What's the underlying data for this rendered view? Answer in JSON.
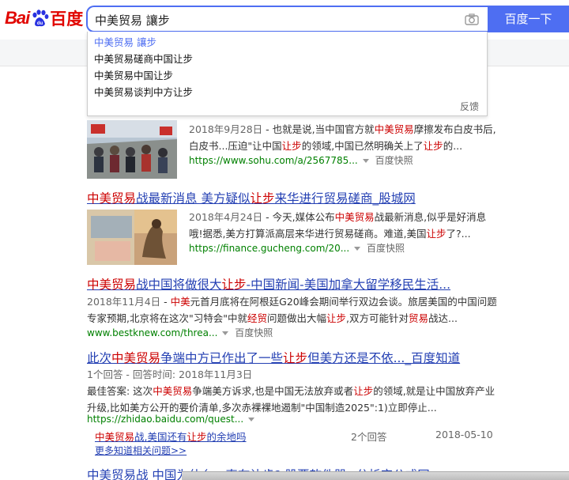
{
  "header": {
    "logo_text_1": "Bai",
    "logo_text_2": "百度",
    "query": "中美贸易 讓步",
    "search_button": "百度一下"
  },
  "suggestions": {
    "items": [
      "中美贸易 讓步",
      "中美贸易磋商中国让步",
      "中美贸易中国让步",
      "中美贸易谈判中方让步"
    ],
    "feedback": "反馈"
  },
  "results": [
    {
      "date": "2018年9月28日",
      "line1_a": " - 也就是说,当中国官方就",
      "line1_em": "中美贸易",
      "line1_b": "摩擦发布白皮书后,",
      "line2_a": "白皮书...压迫\"让中国",
      "line2_em1": "让步",
      "line2_b": "的领域,中国已然明确关上了",
      "line2_em2": "让步",
      "line2_c": "的...",
      "url": "https://www.sohu.com/a/2567785...",
      "snapshot": "百度快照"
    },
    {
      "title_em": "中美贸易",
      "title_a": "战最新消息 美方疑似",
      "title_em2": "让步",
      "title_b": "来华进行贸易磋商_股城网",
      "date": "2018年4月24日",
      "line1_a": " - 今天,媒体公布",
      "line1_em": "中美贸易",
      "line1_b": "战最新消息,似乎是好消息",
      "line2_a": "哦!据悉,美方打算派高层来华进行贸易磋商。难道,美国",
      "line2_em": "让步",
      "line2_b": "了?...",
      "url": "https://finance.gucheng.com/20...",
      "snapshot": "百度快照"
    },
    {
      "title_em": "中美贸易",
      "title_a": "战中国将做很大",
      "title_em2": "让步",
      "title_b": "-中国新闻-美国加拿大留学移民生活...",
      "date": "2018年11月4日",
      "line1_a": " - ",
      "line1_em": "中美",
      "line1_b": "元首月底将在阿根廷G20峰会期间举行双边会谈。旅居美国的中国问题",
      "line2_a": "专家预期,北京将在这次\"习特会\"中就",
      "line2_em1": "经贸",
      "line2_b": "问题做出大幅",
      "line2_em2": "让步",
      "line2_c": ",双方可能针对",
      "line2_em3": "贸易",
      "line2_d": "战达...",
      "url": "www.bestknew.com/threa...",
      "snapshot": "百度快照"
    },
    {
      "title_a": "此次",
      "title_em": "中美贸易",
      "title_b": "争端中方已作出了一些",
      "title_em2": "让步",
      "title_c": "但美方还是不依..._百度知道",
      "meta": "1个回答 - 回答时间: 2018年11月3日",
      "line1_a": "最佳答案: 这次",
      "line1_em": "中美贸易",
      "line1_b": "争端美方诉求,也是中国无法放弃或者",
      "line1_em2": "让步",
      "line1_c": "的领域,就是让中国放弃产业",
      "line2": "升级,比如美方公开的要价清单,多次赤裸裸地遏制\"中国制造2025\":1)立即停止...",
      "url": "https://zhidao.baidu.com/quest...",
      "sub_em": "中美贸易",
      "sub_a": "战,美国还有",
      "sub_em2": "让步",
      "sub_b": "的余地吗",
      "sub_answers": "2个回答",
      "sub_date": "2018-05-10",
      "more": "更多知道相关问题>>"
    }
  ],
  "cutoff_title": "中美贸易战 中国为什么一直在让步? 股票软件器 _分析宝公式网",
  "colors": {
    "accent": "#4e6ef2",
    "link": "#2440b3",
    "highlight": "#cc0000",
    "url": "#008000",
    "logo_red": "#e10601"
  }
}
